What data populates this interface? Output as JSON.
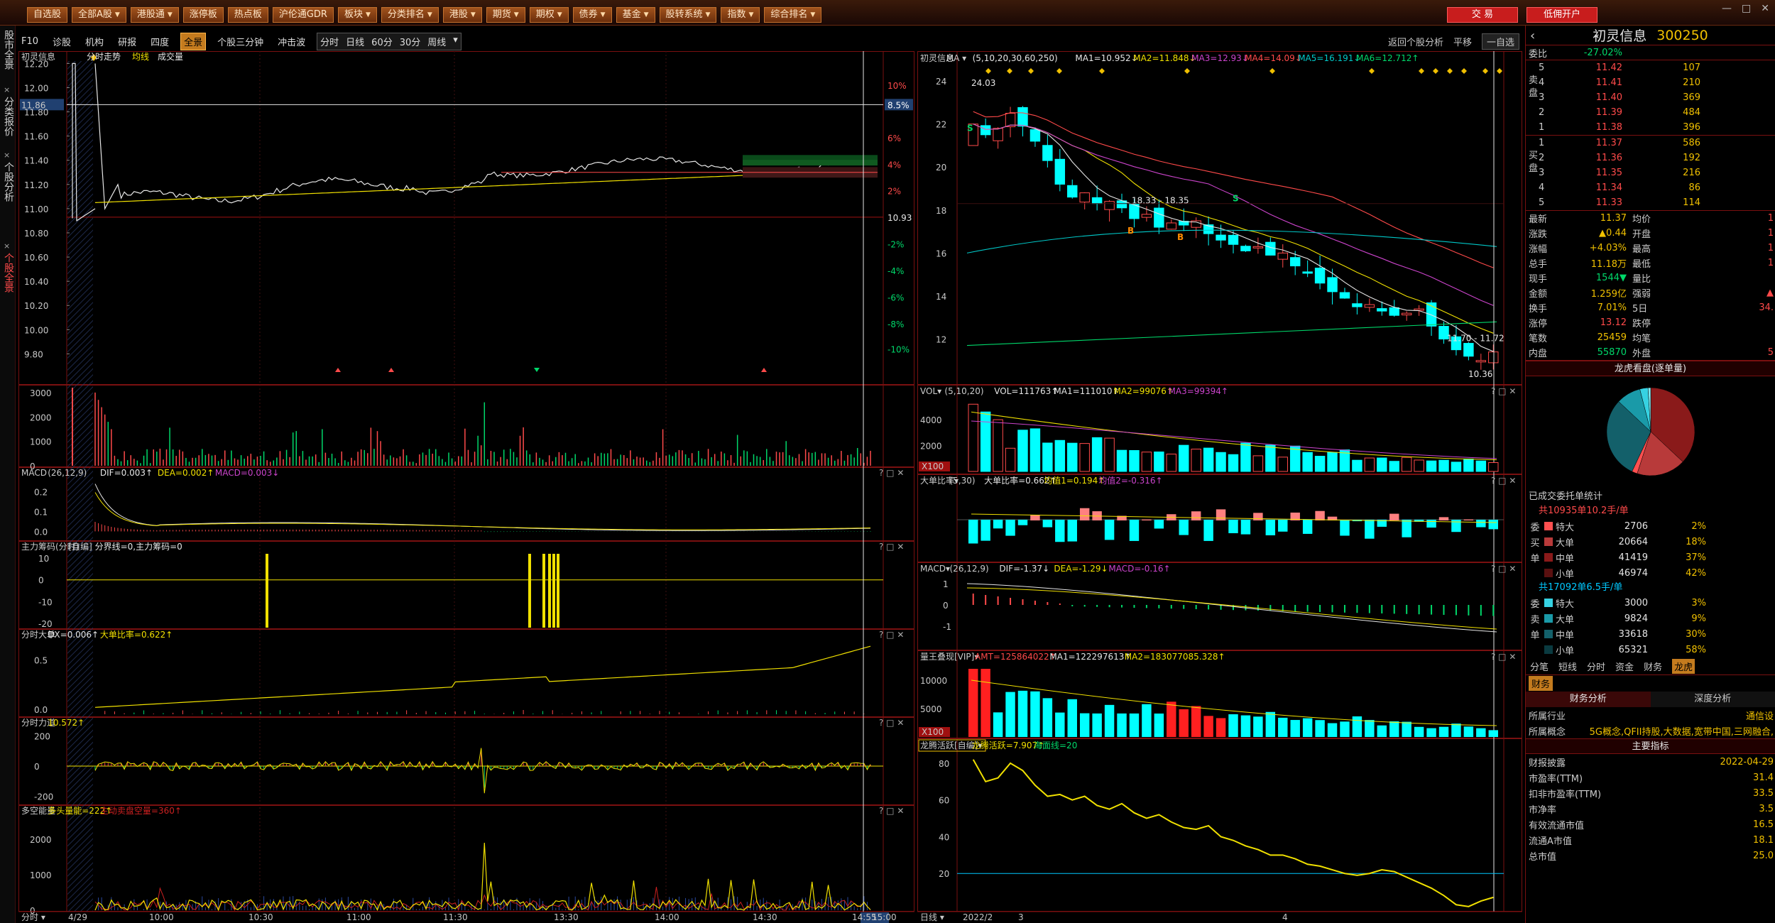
{
  "menu": [
    {
      "label": "自选股",
      "dd": false
    },
    {
      "label": "全部A股",
      "dd": true
    },
    {
      "label": "港股通",
      "dd": true
    },
    {
      "label": "涨停板",
      "dd": false
    },
    {
      "label": "热点板",
      "dd": false
    },
    {
      "label": "沪伦通GDR",
      "dd": false
    },
    {
      "label": "板块",
      "dd": true
    },
    {
      "label": "分类排名",
      "dd": true
    },
    {
      "label": "港股",
      "dd": true
    },
    {
      "label": "期货",
      "dd": true
    },
    {
      "label": "期权",
      "dd": true
    },
    {
      "label": "债券",
      "dd": true
    },
    {
      "label": "基金",
      "dd": true
    },
    {
      "label": "股转系统",
      "dd": true
    },
    {
      "label": "指数",
      "dd": true
    },
    {
      "label": "综合排名",
      "dd": true
    }
  ],
  "trade_buttons": [
    "交 易",
    "低佣开户"
  ],
  "window_controls": [
    "—",
    "□",
    "✕"
  ],
  "left_tabs": [
    {
      "label": "股市全景",
      "active": false
    },
    {
      "label": "分类报价",
      "active": false
    },
    {
      "label": "个股分析",
      "active": false
    },
    {
      "label": "个股全景",
      "active": true
    }
  ],
  "toolbar": {
    "items": [
      "F10",
      "诊股",
      "机构",
      "研报",
      "四度",
      "全景",
      "个股三分钟",
      "冲击波"
    ],
    "selected": "全景",
    "periods": [
      "分时",
      "日线",
      "60分",
      "30分",
      "周线"
    ],
    "period_dd": true,
    "right_items": [
      "返回个股分析",
      "平移",
      "一自选"
    ]
  },
  "left_chart": {
    "title_name": "初灵信息",
    "title_tag": "分时走势",
    "title_avg": "均线",
    "title_vol": "成交量",
    "price_ticks": [
      "12.20",
      "12.00",
      "11.86",
      "11.80",
      "11.60",
      "11.40",
      "11.20",
      "11.00",
      "10.80",
      "10.60",
      "10.40",
      "10.20",
      "10.00",
      "9.80"
    ],
    "pct_ticks": [
      "10%",
      "8.5%",
      "6%",
      "4%",
      "2%",
      "10.93",
      "-2%",
      "-4%",
      "-6%",
      "-8%",
      "-10%"
    ],
    "prev_close": "10.93",
    "current_price": "11.86",
    "current_pct": "8.5%",
    "time_ticks": [
      "4/29",
      "10:00",
      "10:30",
      "11:00",
      "11:30",
      "13:30",
      "14:00",
      "14:30",
      "14:55",
      "15:00"
    ],
    "volume_ticks": [
      "3000",
      "2000",
      "1000",
      "0"
    ],
    "macd_title": "MACD",
    "macd_params": "(26,12,9)",
    "macd_dif": "DIF=0.003↑",
    "macd_dea": "DEA=0.002↑",
    "macd_val": "MACD=0.003↓",
    "macd_ticks": [
      "0.2",
      "0.1",
      "0.0"
    ],
    "chip_title": "主力筹码(分时)",
    "chip_sub": "[自编]",
    "chip_val": "分界线=0,主力筹码=0",
    "chip_ticks": [
      "10",
      "0",
      "-10",
      "-20"
    ],
    "big_title": "分时大单",
    "big_val_a": "DX=0.006↑",
    "big_val_b": "大单比率=0.622↑",
    "big_ticks": [
      "0.5",
      "0.0"
    ],
    "force_title": "分时力道",
    "force_val": "10.572↑",
    "force_ticks": [
      "200",
      "0",
      "-200"
    ],
    "ls_title": "多空能量",
    "ls_val_a": "多头量能=222↑",
    "ls_val_b": "主动卖盘空量=360↑",
    "ls_ticks": [
      "2000",
      "1000",
      "0"
    ],
    "bottom_label": "分时"
  },
  "right_chart": {
    "title_name": "初灵信息",
    "ma_label": "MA",
    "ma_params": "(5,10,20,30,60,250)",
    "ma_vals": [
      "MA1=10.952↓",
      "MA2=11.848↓",
      "MA3=12.93↓",
      "MA4=14.09↓",
      "MA5=16.191↓",
      "MA6=12.712↑"
    ],
    "price_ticks": [
      "24",
      "22",
      "20",
      "18",
      "16",
      "14",
      "12"
    ],
    "high_label": "24.03",
    "range_label_1": "18.33 - 18.35",
    "range_label_2": "11.70 - 11.72",
    "low_label": "10.36",
    "vol_title": "VOL",
    "vol_params": "(5,10,20)",
    "vol_vals": [
      "VOL=111763↑",
      "MA1=111010↑",
      "MA2=99076↑",
      "MA3=99394↑"
    ],
    "vol_ticks": [
      "4000",
      "2000",
      "X100"
    ],
    "big_title": "大单比率",
    "big_params": "(5,30)",
    "big_vals": [
      "大单比率=0.662↑",
      "均值1=0.194↑",
      "均值2=-0.316↑"
    ],
    "macd_title": "MACD",
    "macd_params": "(26,12,9)",
    "macd_vals": [
      "DIF=-1.37↓",
      "DEA=-1.29↓",
      "MACD=-0.16↑"
    ],
    "macd_ticks": [
      "1",
      "0",
      "-1"
    ],
    "amt_title": "量王叠现[VIP]",
    "amt_vals": [
      "AMT=125864022↑",
      "MA1=122297613↑",
      "MA2=183077085.328↑"
    ],
    "amt_ticks": [
      "10000",
      "5000",
      "X100"
    ],
    "dragon_title": "龙腾活跃[自编]",
    "dragon_vals": [
      "龙腾活跃=7.907↑",
      "海面线=20"
    ],
    "dragon_ticks": [
      "80",
      "60",
      "40",
      "20"
    ],
    "time_ticks": [
      "2022/2",
      "3",
      "4"
    ],
    "bottom_label": "日线"
  },
  "info": {
    "name": "初灵信息",
    "code": "300250",
    "weibi_label": "委比",
    "weibi_val": "-27.02%",
    "sells": [
      [
        "5",
        "11.42",
        "107"
      ],
      [
        "4",
        "11.41",
        "210"
      ],
      [
        "3",
        "11.40",
        "369"
      ],
      [
        "2",
        "11.39",
        "484"
      ],
      [
        "1",
        "11.38",
        "396"
      ]
    ],
    "buys": [
      [
        "1",
        "11.37",
        "586"
      ],
      [
        "2",
        "11.36",
        "192"
      ],
      [
        "3",
        "11.35",
        "216"
      ],
      [
        "4",
        "11.34",
        "86"
      ],
      [
        "5",
        "11.33",
        "114"
      ]
    ],
    "sell_side": "卖盘",
    "buy_side": "买盘",
    "stats": [
      [
        "最新",
        "11.37",
        "均价",
        "1"
      ],
      [
        "涨跌",
        "▲0.44",
        "开盘",
        "1"
      ],
      [
        "涨幅",
        "+4.03%",
        "最高",
        "1"
      ],
      [
        "总手",
        "11.18万",
        "最低",
        "1"
      ],
      [
        "现手",
        "1544▼",
        "量比",
        ""
      ],
      [
        "金额",
        "1.259亿",
        "强弱",
        "▲"
      ],
      [
        "换手",
        "7.01%",
        "5日",
        "34."
      ],
      [
        "涨停",
        "13.12",
        "跌停",
        ""
      ],
      [
        "笔数",
        "25459",
        "均笔",
        ""
      ],
      [
        "内盘",
        "55870",
        "外盘",
        "5"
      ]
    ],
    "pie_title": "龙虎看盘(逐单量)",
    "pie_slices": [
      {
        "pct": 37,
        "color": "#8a1a1a"
      },
      {
        "pct": 18,
        "color": "#b83a3a"
      },
      {
        "pct": 2,
        "color": "#ff5050"
      },
      {
        "pct": 30,
        "color": "#13606a"
      },
      {
        "pct": 9,
        "color": "#1a9aa8"
      },
      {
        "pct": 3,
        "color": "#36d2e2"
      },
      {
        "pct": 1,
        "color": "#7ee8f0"
      }
    ],
    "done_title": "已成交委托单统计",
    "buy_summary": "共10935单10.2手/单",
    "buy_side_labels": [
      "委",
      "买",
      "单"
    ],
    "buy_flow": [
      [
        "特大",
        "2706",
        "2%",
        "#ff5050"
      ],
      [
        "大单",
        "20664",
        "18%",
        "#b83a3a"
      ],
      [
        "中单",
        "41419",
        "37%",
        "#8a1a1a"
      ],
      [
        "小单",
        "46974",
        "42%",
        "#5a1010"
      ]
    ],
    "sell_summary": "共17092单6.5手/单",
    "sell_side_labels": [
      "委",
      "卖",
      "单"
    ],
    "sell_flow": [
      [
        "特大",
        "3000",
        "3%",
        "#36d2e2"
      ],
      [
        "大单",
        "9824",
        "9%",
        "#1a9aa8"
      ],
      [
        "中单",
        "33618",
        "30%",
        "#13606a"
      ],
      [
        "小单",
        "65321",
        "58%",
        "#0a3a40"
      ]
    ],
    "tabs": [
      "分笔",
      "短线",
      "分时",
      "资金",
      "财务",
      "龙虎"
    ],
    "tab_selected": "龙虎",
    "fin_tab": "财务",
    "fin_subtabs": [
      "财务分析",
      "深度分析"
    ],
    "industry_label": "所属行业",
    "industry_val": "通信设",
    "concept_label": "所属概念",
    "concept_val": "5G概念,QFII持股,大数据,宽带中国,三网融合,",
    "main_index": "主要指标",
    "fin_rows": [
      [
        "财报披露",
        "2022-04-29"
      ],
      [
        "市盈率(TTM)",
        "31.4"
      ],
      [
        "扣非市盈率(TTM)",
        "33.5"
      ],
      [
        "市净率",
        "3.5"
      ],
      [
        "有效流通市值",
        "16.5"
      ],
      [
        "流通A市值",
        "18.1"
      ],
      [
        "总市值",
        "25.0"
      ]
    ]
  },
  "colors": {
    "up": "#ff4a4a",
    "down": "#00ffff",
    "price_line": "#ffffff",
    "avg_line": "#f0e000",
    "border": "#7a1010"
  }
}
